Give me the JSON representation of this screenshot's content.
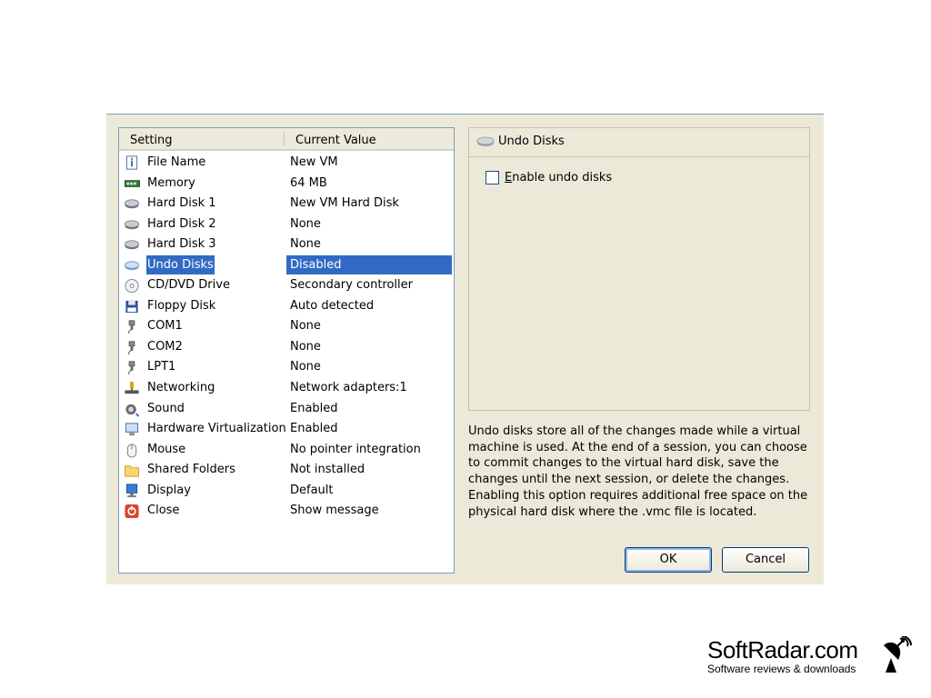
{
  "list": {
    "columns": [
      "Setting",
      "Current Value"
    ],
    "rows": [
      {
        "name": "File Name",
        "value": "New VM",
        "icon": "file-info-icon"
      },
      {
        "name": "Memory",
        "value": "64 MB",
        "icon": "memory-icon"
      },
      {
        "name": "Hard Disk 1",
        "value": "New VM Hard Disk",
        "icon": "hard-disk-icon"
      },
      {
        "name": "Hard Disk 2",
        "value": "None",
        "icon": "hard-disk-icon"
      },
      {
        "name": "Hard Disk 3",
        "value": "None",
        "icon": "hard-disk-icon"
      },
      {
        "name": "Undo Disks",
        "value": "Disabled",
        "icon": "undo-disks-icon",
        "selected": true
      },
      {
        "name": "CD/DVD Drive",
        "value": "Secondary controller",
        "icon": "cd-icon"
      },
      {
        "name": "Floppy Disk",
        "value": "Auto detected",
        "icon": "floppy-icon"
      },
      {
        "name": "COM1",
        "value": "None",
        "icon": "com-port-icon"
      },
      {
        "name": "COM2",
        "value": "None",
        "icon": "com-port-icon"
      },
      {
        "name": "LPT1",
        "value": "None",
        "icon": "lpt-port-icon"
      },
      {
        "name": "Networking",
        "value": "Network adapters:1",
        "icon": "network-icon"
      },
      {
        "name": "Sound",
        "value": "Enabled",
        "icon": "sound-icon"
      },
      {
        "name": "Hardware Virtualization",
        "value": "Enabled",
        "icon": "hardware-virtualization-icon"
      },
      {
        "name": "Mouse",
        "value": "No pointer integration",
        "icon": "mouse-icon"
      },
      {
        "name": "Shared Folders",
        "value": "Not installed",
        "icon": "folder-icon"
      },
      {
        "name": "Display",
        "value": "Default",
        "icon": "display-icon"
      },
      {
        "name": "Close",
        "value": "Show message",
        "icon": "close-power-icon"
      }
    ]
  },
  "panel": {
    "title": "Undo Disks",
    "checkbox_label": "Enable undo disks",
    "checkbox_checked": false
  },
  "description": "Undo disks store all of the changes made while a virtual machine is used. At the end of a session, you can choose to commit changes to the virtual hard disk, save the changes until the next session, or delete the changes. Enabling this option requires additional free space on the physical hard disk where the .vmc file is located.",
  "buttons": {
    "ok": "OK",
    "cancel": "Cancel"
  },
  "watermark": {
    "title": "SoftRadar.com",
    "subtitle": "Software reviews & downloads"
  },
  "colors": {
    "selection": "#316ac5",
    "dialog_bg": "#ece9d8",
    "border": "#7f9db9"
  }
}
